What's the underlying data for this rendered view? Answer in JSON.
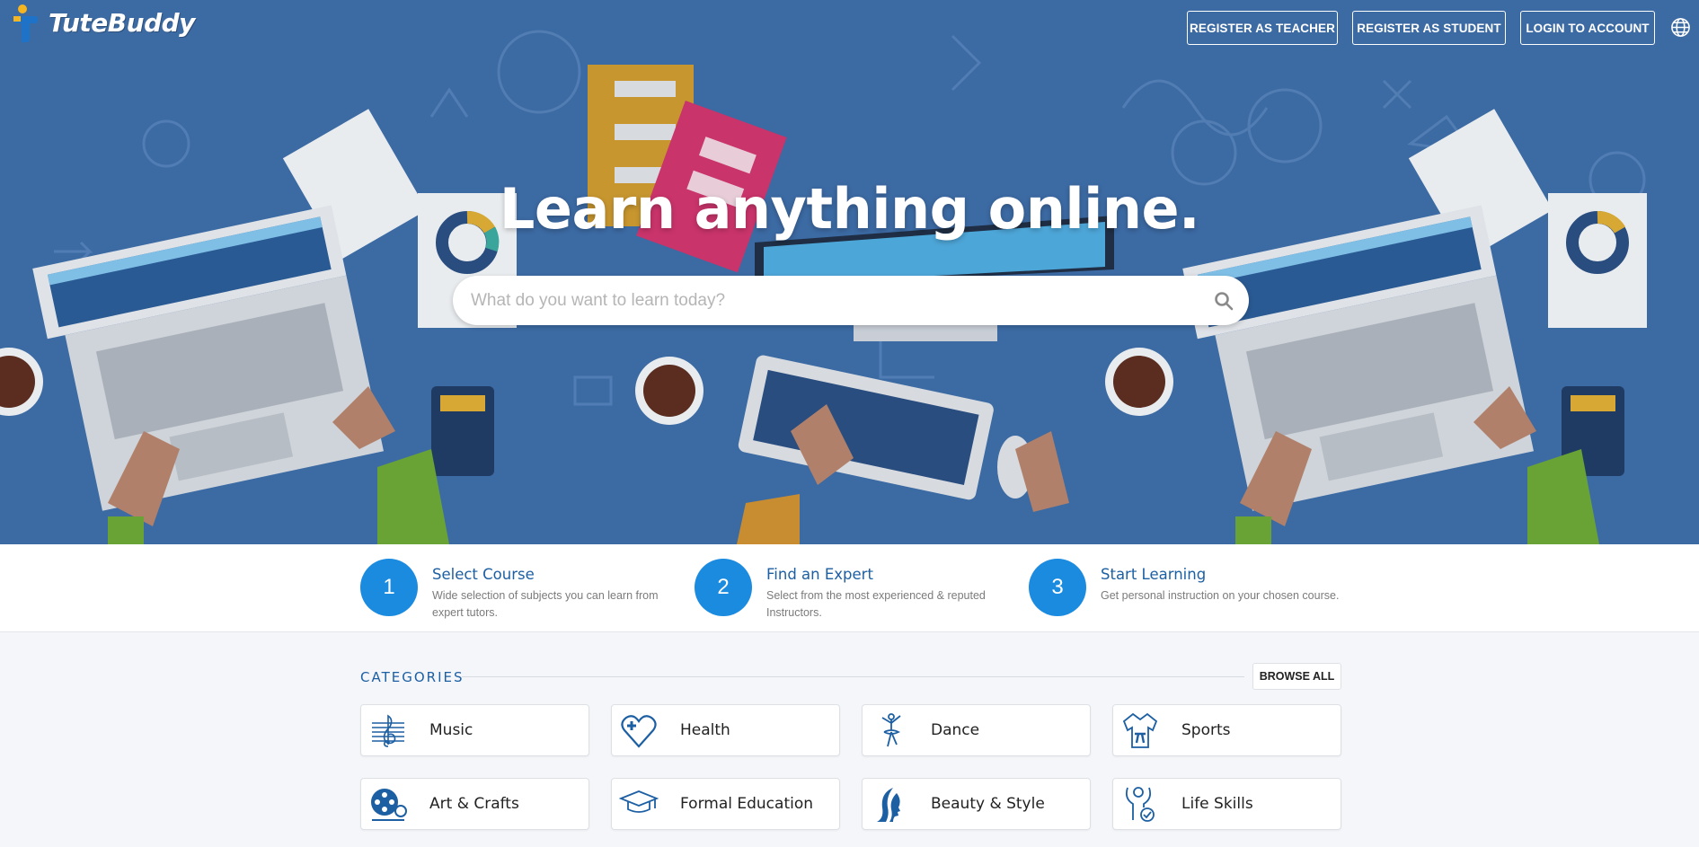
{
  "brand": {
    "name": "TuteBuddy"
  },
  "nav": {
    "register_teacher": "REGISTER AS TEACHER",
    "register_student": "REGISTER AS STUDENT",
    "login": "LOGIN TO ACCOUNT",
    "language_icon": "globe-icon"
  },
  "hero": {
    "headline": "Learn anything online.",
    "search_placeholder": "What do you want to learn today?",
    "search_icon": "search-icon"
  },
  "steps": [
    {
      "number": "1",
      "title": "Select Course",
      "description": "Wide selection of subjects you can learn from expert tutors."
    },
    {
      "number": "2",
      "title": "Find an Expert",
      "description": "Select from the most experienced & reputed Instructors."
    },
    {
      "number": "3",
      "title": "Start Learning",
      "description": "Get personal instruction on your chosen course."
    }
  ],
  "categories": {
    "title": "CATEGORIES",
    "browse_all": "BROWSE ALL",
    "items": [
      {
        "label": "Music",
        "icon": "treble-clef-icon"
      },
      {
        "label": "Health",
        "icon": "heart-plus-icon"
      },
      {
        "label": "Dance",
        "icon": "dancer-icon"
      },
      {
        "label": "Sports",
        "icon": "martial-arts-uniform-icon"
      },
      {
        "label": "Art & Crafts",
        "icon": "film-reel-icon"
      },
      {
        "label": "Formal Education",
        "icon": "graduation-cap-icon"
      },
      {
        "label": "Beauty & Style",
        "icon": "woman-profile-icon"
      },
      {
        "label": "Life Skills",
        "icon": "person-check-icon"
      }
    ]
  },
  "colors": {
    "hero_bg": "#3c6aa3",
    "accent": "#1b8be0",
    "link": "#1d5fa3"
  }
}
